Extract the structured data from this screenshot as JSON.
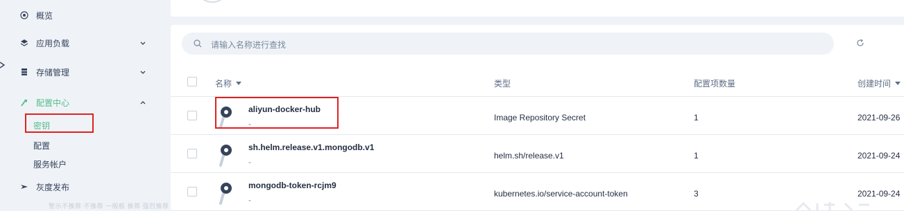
{
  "sidebar": {
    "items": [
      {
        "label": "概览",
        "icon": "overview-icon"
      },
      {
        "label": "应用负载",
        "icon": "workload-icon"
      },
      {
        "label": "存储管理",
        "icon": "storage-icon"
      },
      {
        "label": "配置中心",
        "icon": "config-icon"
      },
      {
        "label": "灰度发布",
        "icon": "grayscale-icon"
      }
    ],
    "config_sub": [
      {
        "label": "密钥"
      },
      {
        "label": "配置"
      },
      {
        "label": "服务帐户"
      }
    ],
    "faded_text": "警示不推荐 不推荐 一般般 推荐 强烈推荐"
  },
  "search": {
    "placeholder": "请输入名称进行查找"
  },
  "table": {
    "headers": {
      "name": "名称",
      "type": "类型",
      "count": "配置项数量",
      "created": "创建时间"
    },
    "rows": [
      {
        "name": "aliyun-docker-hub",
        "desc": "-",
        "type": "Image Repository Secret",
        "count": "1",
        "created": "2021-09-26"
      },
      {
        "name": "sh.helm.release.v1.mongodb.v1",
        "desc": "-",
        "type": "helm.sh/release.v1",
        "count": "1",
        "created": "2021-09-24"
      },
      {
        "name": "mongodb-token-rcjm9",
        "desc": "-",
        "type": "kubernetes.io/service-account-token",
        "count": "3",
        "created": "2021-09-24"
      }
    ]
  },
  "colors": {
    "accent": "#55bc8a",
    "highlight": "#e02020",
    "text": "#242e42",
    "muted": "#79879c"
  }
}
